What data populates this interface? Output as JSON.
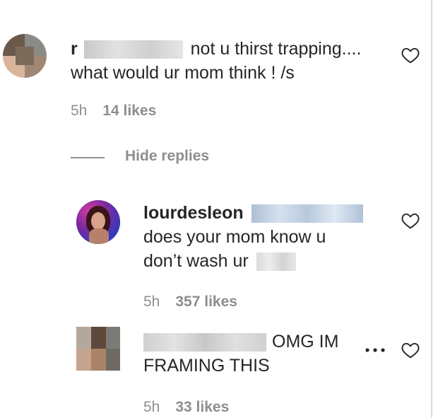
{
  "comments": [
    {
      "text_line1": "not u thirst trapping....",
      "text_line2": "what would ur mom think ! /s",
      "username_initial": "r",
      "time": "5h",
      "likes": "14 likes"
    }
  ],
  "replies_toggle": {
    "label": "Hide replies"
  },
  "replies": [
    {
      "username": "lourdesleon",
      "text_line1": "does your mom know u",
      "text_line2": "don’t wash ur",
      "time": "5h",
      "likes": "357 likes"
    },
    {
      "text_line1": "OMG IM",
      "text_line2": "FRAMING THIS",
      "time": "5h",
      "likes": "33 likes"
    }
  ],
  "icons": {
    "like": "heart-outline-icon",
    "more": "more-options-icon"
  },
  "colors": {
    "text": "#262626",
    "muted": "#8e8e8e",
    "divider": "#dbdbdb"
  }
}
